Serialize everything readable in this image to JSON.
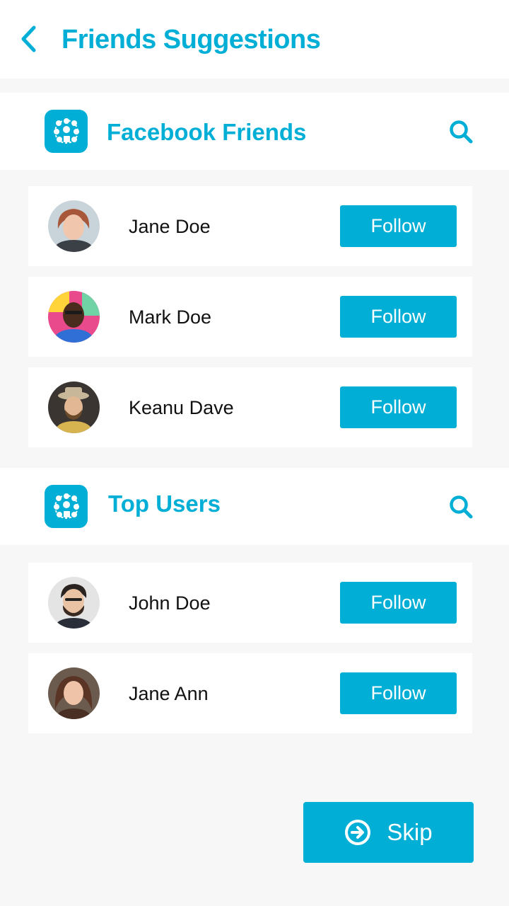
{
  "header": {
    "title": "Friends Suggestions",
    "back_icon": "chevron-left-icon"
  },
  "colors": {
    "accent": "#00aed6",
    "background": "#f7f7f7",
    "card": "#ffffff",
    "text": "#111111"
  },
  "sections": [
    {
      "title": "Facebook Friends",
      "icon": "community-app-icon",
      "search_icon": "search-icon",
      "users": [
        {
          "name": "Jane Doe",
          "button": "Follow"
        },
        {
          "name": "Mark Doe",
          "button": "Follow"
        },
        {
          "name": "Keanu Dave",
          "button": "Follow"
        }
      ]
    },
    {
      "title": "Top Users",
      "icon": "community-app-icon",
      "search_icon": "search-icon",
      "users": [
        {
          "name": "John Doe",
          "button": "Follow"
        },
        {
          "name": "Jane Ann",
          "button": "Follow"
        }
      ]
    }
  ],
  "skip": {
    "label": "Skip",
    "icon": "arrow-right-circle-icon"
  }
}
